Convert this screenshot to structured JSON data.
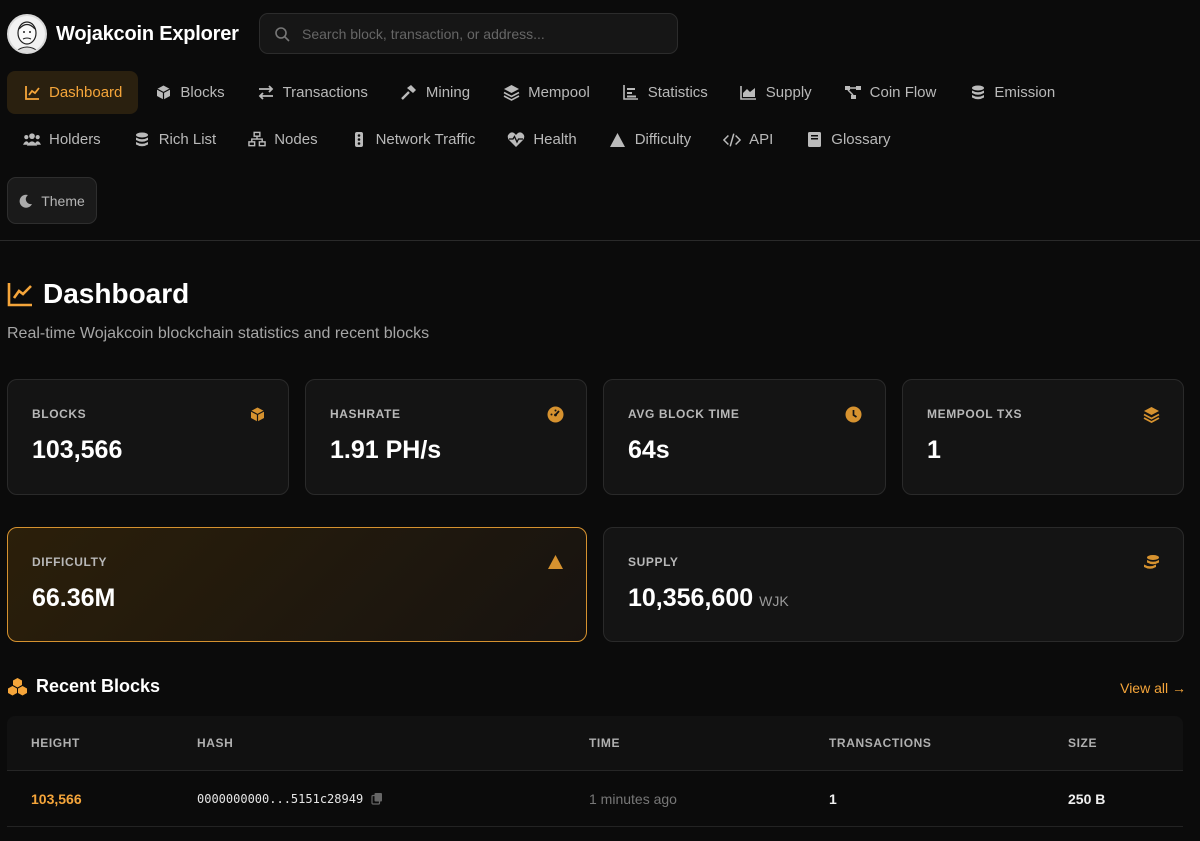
{
  "brand": {
    "title": "Wojakcoin Explorer"
  },
  "search": {
    "placeholder": "Search block, transaction, or address..."
  },
  "nav": {
    "row1": [
      {
        "label": "Dashboard",
        "icon": "chart-line-icon",
        "active": true
      },
      {
        "label": "Blocks",
        "icon": "cube-icon"
      },
      {
        "label": "Transactions",
        "icon": "arrows-exchange-icon"
      },
      {
        "label": "Mining",
        "icon": "hammer-icon"
      },
      {
        "label": "Mempool",
        "icon": "layers-icon"
      },
      {
        "label": "Statistics",
        "icon": "bar-chart-icon"
      },
      {
        "label": "Supply",
        "icon": "area-chart-icon"
      },
      {
        "label": "Coin Flow",
        "icon": "flow-icon"
      },
      {
        "label": "Emission",
        "icon": "coins-icon"
      }
    ],
    "row2": [
      {
        "label": "Holders",
        "icon": "users-icon"
      },
      {
        "label": "Rich List",
        "icon": "coins-icon"
      },
      {
        "label": "Nodes",
        "icon": "network-icon"
      },
      {
        "label": "Network Traffic",
        "icon": "traffic-icon"
      },
      {
        "label": "Health",
        "icon": "heart-pulse-icon"
      },
      {
        "label": "Difficulty",
        "icon": "warning-icon"
      },
      {
        "label": "API",
        "icon": "code-icon"
      },
      {
        "label": "Glossary",
        "icon": "book-icon"
      }
    ],
    "theme_label": "Theme"
  },
  "page": {
    "title": "Dashboard",
    "subtitle": "Real-time Wojakcoin blockchain statistics and recent blocks"
  },
  "stats": {
    "blocks": {
      "label": "BLOCKS",
      "value": "103,566"
    },
    "hashrate": {
      "label": "HASHRATE",
      "value": "1.91 PH/s"
    },
    "avg_block_time": {
      "label": "AVG BLOCK TIME",
      "value": "64s"
    },
    "mempool": {
      "label": "MEMPOOL TXS",
      "value": "1"
    },
    "difficulty": {
      "label": "DIFFICULTY",
      "value": "66.36M"
    },
    "supply": {
      "label": "SUPPLY",
      "value": "10,356,600",
      "unit": "WJK"
    }
  },
  "recent": {
    "title": "Recent Blocks",
    "view_all": "View all →",
    "headers": [
      "HEIGHT",
      "HASH",
      "TIME",
      "TRANSACTIONS",
      "SIZE"
    ],
    "rows": [
      {
        "height": "103,566",
        "hash": "0000000000...5151c28949",
        "time": "1 minutes ago",
        "transactions": "1",
        "size": "250 B"
      }
    ]
  },
  "colors": {
    "accent": "#f5a53a",
    "background": "#0b0b0b",
    "card": "#141414"
  }
}
